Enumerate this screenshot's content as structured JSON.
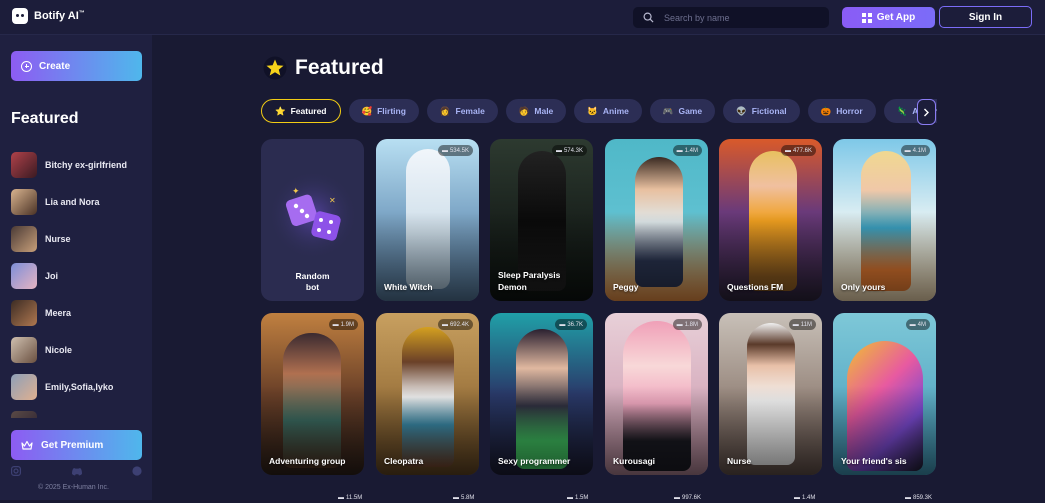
{
  "app": {
    "brand": "Botify AI",
    "brand_mark": "™"
  },
  "header": {
    "search_placeholder": "Search by name",
    "get_app_label": "Get App",
    "sign_in_label": "Sign In"
  },
  "sidebar": {
    "create_label": "Create",
    "heading": "Featured",
    "items": [
      {
        "label": "Bitchy ex-girlfriend"
      },
      {
        "label": "Lia and Nora"
      },
      {
        "label": "Nurse"
      },
      {
        "label": "Joi"
      },
      {
        "label": "Meera"
      },
      {
        "label": "Nicole"
      },
      {
        "label": "Emily,Sofia,Iyko"
      },
      {
        "label": ""
      }
    ],
    "premium_label": "Get Premium",
    "copyright": "© 2025 Ex-Human Inc."
  },
  "main": {
    "title": "Featured",
    "chips": [
      {
        "label": "Featured",
        "emoji": "⭐",
        "active": true
      },
      {
        "label": "Flirting",
        "emoji": "🥰"
      },
      {
        "label": "Female",
        "emoji": "👩"
      },
      {
        "label": "Male",
        "emoji": "🧑"
      },
      {
        "label": "Anime",
        "emoji": "🐱"
      },
      {
        "label": "Game",
        "emoji": "🎮"
      },
      {
        "label": "Fictional",
        "emoji": "👽"
      },
      {
        "label": "Horror",
        "emoji": "🎃"
      },
      {
        "label": "Action",
        "emoji": "🦎"
      }
    ],
    "random_card": {
      "line1": "Random",
      "line2": "bot"
    },
    "cards": [
      {
        "name": "White Witch",
        "count": "534.5K"
      },
      {
        "name": "Sleep Paralysis Demon",
        "count": "574.3K"
      },
      {
        "name": "Peggy",
        "count": "1.4M"
      },
      {
        "name": "Questions FM",
        "count": "477.6K"
      },
      {
        "name": "Only yours",
        "count": "4.1M"
      },
      {
        "name": "Adventuring group",
        "count": "1.9M"
      },
      {
        "name": "Cleopatra",
        "count": "692.4K"
      },
      {
        "name": "Sexy programmer",
        "count": "36.7K"
      },
      {
        "name": "Kurousagi",
        "count": "1.8M"
      },
      {
        "name": "Nurse",
        "count": "11M"
      },
      {
        "name": "Your friend's sis",
        "count": "4M"
      }
    ],
    "bottom_counts": [
      "11.5M",
      "5.8M",
      "1.5M",
      "997.6K",
      "1.4M",
      "859.3K"
    ]
  },
  "colors": {
    "accent": "#7b6cf8",
    "active_chip_border": "#f2cc14",
    "background": "#191a33"
  }
}
